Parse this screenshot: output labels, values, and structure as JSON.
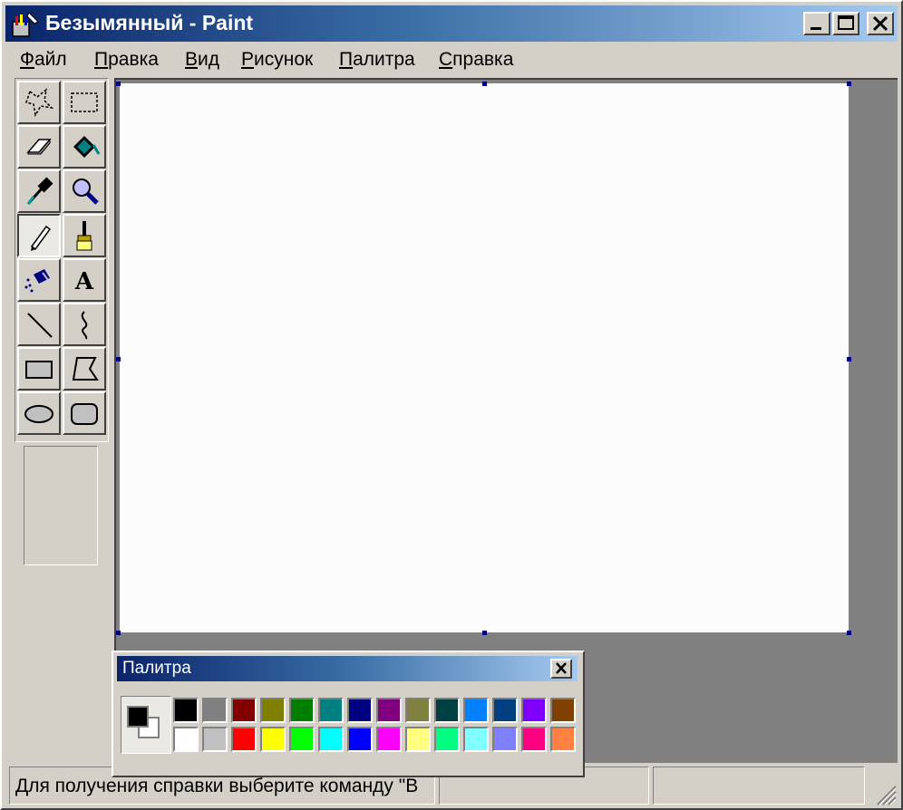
{
  "window": {
    "title": "Безымянный - Paint",
    "title_icon": "paint-app-icon",
    "controls": [
      "minimize-icon",
      "maximize-icon",
      "close-icon"
    ]
  },
  "menu": [
    {
      "first": "Ф",
      "rest": "айл"
    },
    {
      "first": "П",
      "rest": "равка"
    },
    {
      "first": "В",
      "rest": "ид"
    },
    {
      "first": "Р",
      "rest": "исунок"
    },
    {
      "first": "П",
      "rest": "алитра"
    },
    {
      "first": "С",
      "rest": "правка"
    }
  ],
  "tools": [
    {
      "icon": "free-form-select-icon",
      "active": false
    },
    {
      "icon": "rect-select-icon",
      "active": false
    },
    {
      "icon": "eraser-icon",
      "active": false
    },
    {
      "icon": "fill-bucket-icon",
      "active": false
    },
    {
      "icon": "color-picker-icon",
      "active": false
    },
    {
      "icon": "magnifier-icon",
      "active": false
    },
    {
      "icon": "pencil-icon",
      "active": true
    },
    {
      "icon": "brush-icon",
      "active": false
    },
    {
      "icon": "airbrush-icon",
      "active": false
    },
    {
      "icon": "text-tool-icon",
      "active": false,
      "glyph": "A"
    },
    {
      "icon": "line-icon",
      "active": false
    },
    {
      "icon": "curve-icon",
      "active": false
    },
    {
      "icon": "rectangle-icon",
      "active": false
    },
    {
      "icon": "polygon-icon",
      "active": false
    },
    {
      "icon": "ellipse-icon",
      "active": false
    },
    {
      "icon": "rounded-rectangle-icon",
      "active": false
    }
  ],
  "palette": {
    "title": "Палитра",
    "foreground": "#000000",
    "background": "#ffffff",
    "colors_top": [
      "#000000",
      "#808080",
      "#800000",
      "#808000",
      "#008000",
      "#008080",
      "#000080",
      "#800080",
      "#808040",
      "#004040",
      "#0080ff",
      "#004080",
      "#8000ff",
      "#804000"
    ],
    "colors_bottom": [
      "#ffffff",
      "#c0c0c0",
      "#ff0000",
      "#ffff00",
      "#00ff00",
      "#00ffff",
      "#0000ff",
      "#ff00ff",
      "#ffff80",
      "#00ff80",
      "#80ffff",
      "#8080ff",
      "#ff0080",
      "#ff8040"
    ]
  },
  "status": {
    "text": "Для получения справки выберите команду \"В"
  }
}
